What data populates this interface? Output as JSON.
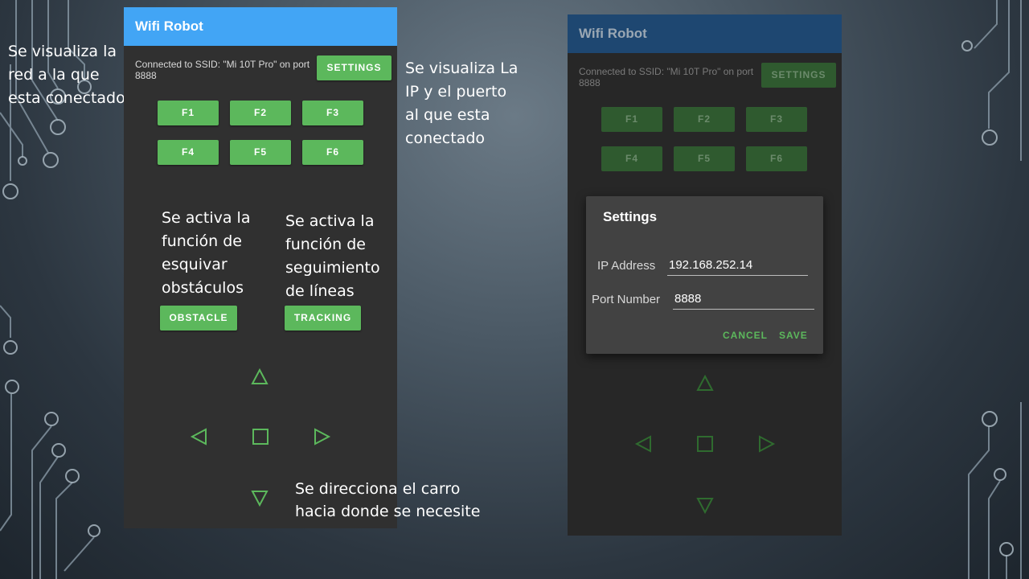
{
  "annotations": {
    "network": "Se visualiza la\nred a la que\nesta conectado",
    "ip_port": "Se visualiza La\nIP y el puerto\nal que esta\nconectado",
    "obstacle": "Se activa la\nfunción de\nesquivar\nobstáculos",
    "tracking": "Se activa la\nfunción de\nseguimiento\nde líneas",
    "direction": "Se direcciona el carro\nhacia donde se necesite"
  },
  "app": {
    "title": "Wifi Robot",
    "status": "Connected to SSID: \"Mi 10T Pro\" on port\n8888",
    "settings_label": "SETTINGS",
    "function_buttons": [
      "F1",
      "F2",
      "F3",
      "F4",
      "F5",
      "F6"
    ],
    "obstacle_label": "OBSTACLE",
    "tracking_label": "TRACKING",
    "icons": {
      "up": "triangle-up-outline",
      "left": "triangle-left-outline",
      "stop": "square-outline",
      "right": "triangle-right-outline",
      "down": "triangle-down-outline"
    }
  },
  "settings_dialog": {
    "title": "Settings",
    "ip_label": "IP Address",
    "ip_value": "192.168.252.14",
    "port_label": "Port Number",
    "port_value": "8888",
    "cancel_label": "CANCEL",
    "save_label": "SAVE"
  },
  "colors": {
    "appbar": "#42a5f5",
    "appbar_dim": "#1e4771",
    "accent_green": "#5cb85c",
    "app_background": "#303030",
    "dialog_background": "#424242"
  }
}
